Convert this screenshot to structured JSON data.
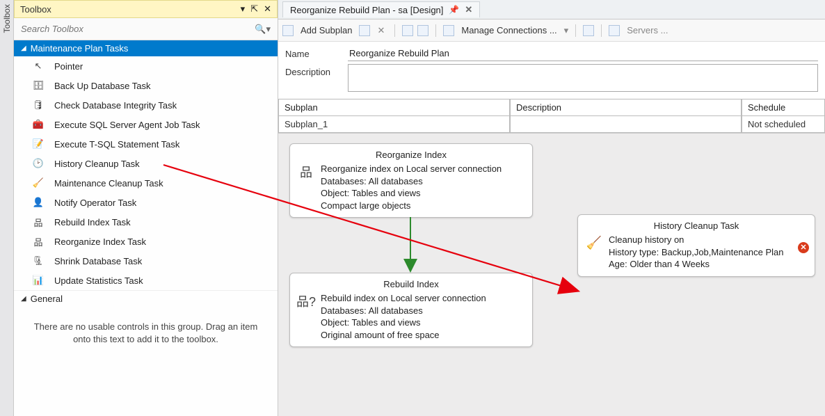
{
  "side_tab": {
    "label": "Toolbox"
  },
  "panel": {
    "title": "Toolbox"
  },
  "search": {
    "placeholder": "Search Toolbox"
  },
  "groups": {
    "tasks": {
      "header": "Maintenance Plan Tasks"
    },
    "general": {
      "header": "General",
      "empty": "There are no usable controls in this group. Drag an item onto this text to add it to the toolbox."
    }
  },
  "tasks": [
    {
      "icon": "↖",
      "label": "Pointer"
    },
    {
      "icon": "🗄",
      "label": "Back Up Database Task"
    },
    {
      "icon": "🛢",
      "label": "Check Database Integrity Task"
    },
    {
      "icon": "🧰",
      "label": "Execute SQL Server Agent Job Task"
    },
    {
      "icon": "📝",
      "label": "Execute T-SQL Statement Task"
    },
    {
      "icon": "🕑",
      "label": "History Cleanup Task"
    },
    {
      "icon": "🧹",
      "label": "Maintenance Cleanup Task"
    },
    {
      "icon": "👤",
      "label": "Notify Operator Task"
    },
    {
      "icon": "品",
      "label": "Rebuild Index Task"
    },
    {
      "icon": "品",
      "label": "Reorganize Index Task"
    },
    {
      "icon": "🗜",
      "label": "Shrink Database Task"
    },
    {
      "icon": "📊",
      "label": "Update Statistics Task"
    }
  ],
  "doc_tab": {
    "title": "Reorganize Rebuild Plan - sa [Design]"
  },
  "toolbar": {
    "add_subplan": "Add Subplan",
    "manage_conn": "Manage Connections ...",
    "servers": "Servers ..."
  },
  "props": {
    "name_label": "Name",
    "name_value": "Reorganize Rebuild Plan",
    "desc_label": "Description",
    "desc_value": ""
  },
  "grid": {
    "headers": {
      "subplan": "Subplan",
      "description": "Description",
      "schedule": "Schedule"
    },
    "row": {
      "subplan": "Subplan_1",
      "description": "",
      "schedule": "Not scheduled "
    }
  },
  "nodes": {
    "reorg": {
      "title": "Reorganize Index",
      "lines": [
        "Reorganize index on Local server connection",
        "Databases: All databases",
        "Object: Tables and views",
        "Compact large objects"
      ]
    },
    "rebuild": {
      "title": "Rebuild Index",
      "lines": [
        "Rebuild index on Local server connection",
        "Databases: All databases",
        "Object: Tables and views",
        "Original amount of free space"
      ]
    },
    "history": {
      "title": "History Cleanup Task",
      "lines": [
        "Cleanup history on",
        "History type: Backup,Job,Maintenance Plan",
        "Age: Older than 4 Weeks"
      ]
    }
  }
}
